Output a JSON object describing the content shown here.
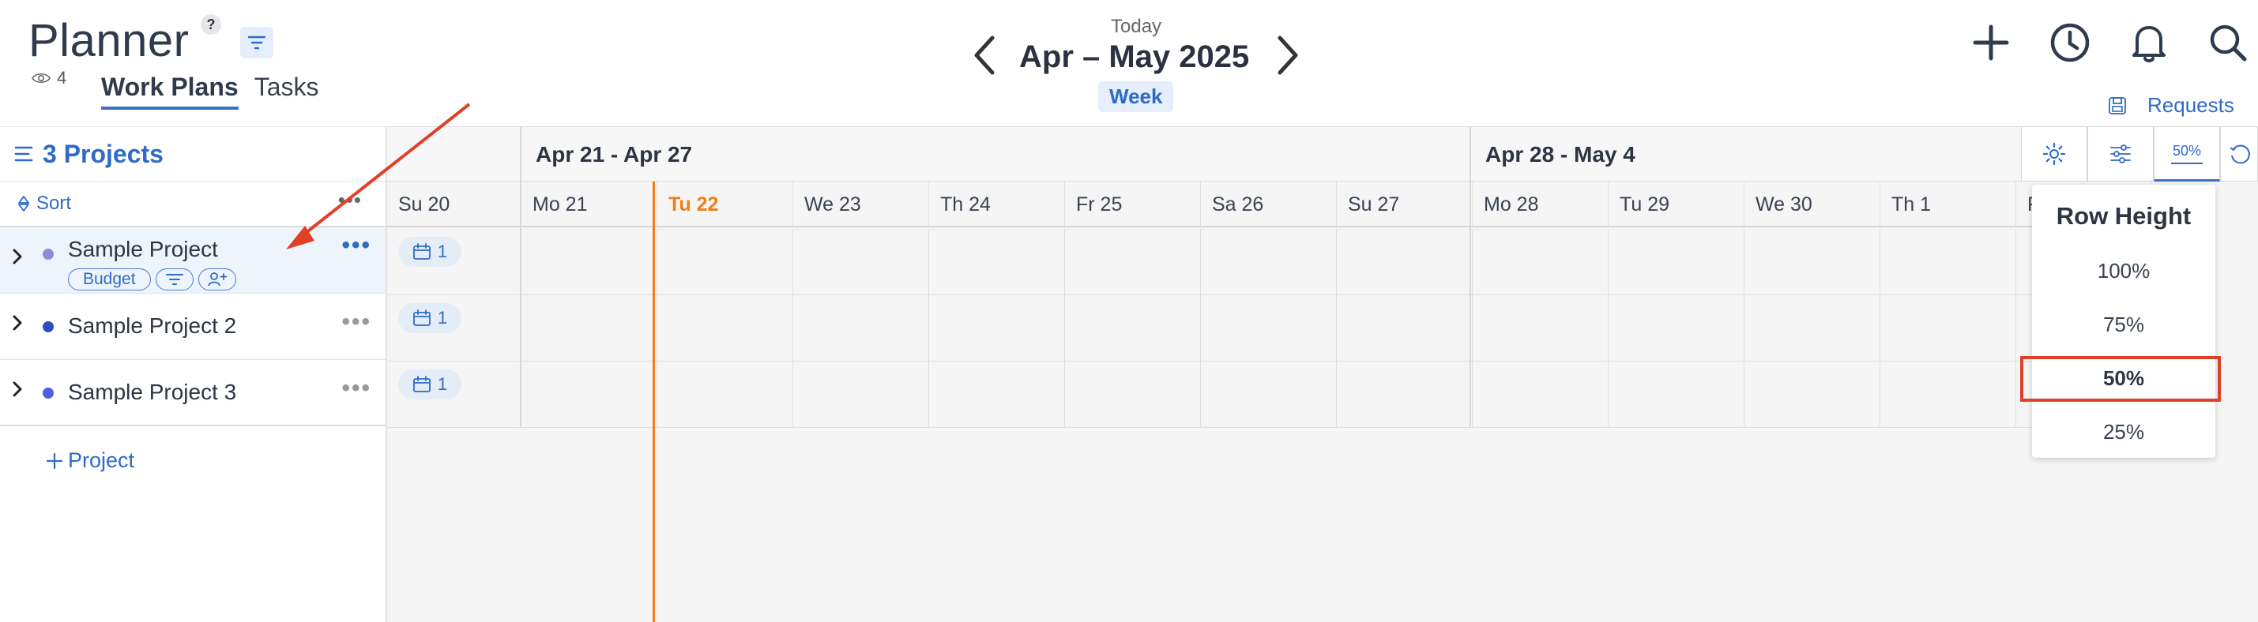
{
  "header": {
    "title": "Planner",
    "help": "?",
    "viewer_count": "4",
    "tabs": [
      {
        "label": "Work Plans",
        "active": true
      },
      {
        "label": "Tasks",
        "active": false
      }
    ],
    "today_label": "Today",
    "date_range": "Apr – May 2025",
    "scale": "Week",
    "requests_label": "Requests",
    "icons": [
      "plus-icon",
      "clock-icon",
      "bell-icon",
      "search-icon"
    ]
  },
  "sidebar": {
    "projects_title": "3 Projects",
    "sort_label": "Sort",
    "projects": [
      {
        "name": "Sample Project",
        "color": "#8a8fd6",
        "selected": true,
        "chips": [
          "Budget"
        ],
        "count": "1"
      },
      {
        "name": "Sample Project 2",
        "color": "#2d4fc2",
        "selected": false,
        "chips": [],
        "count": "1"
      },
      {
        "name": "Sample Project 3",
        "color": "#4f5fe0",
        "selected": false,
        "chips": [],
        "count": "1"
      }
    ],
    "add_project_label": "Project"
  },
  "timeline": {
    "weeks": [
      "Apr 21 - Apr 27",
      "Apr 28 - May 4"
    ],
    "days": [
      "Su 20",
      "Mo 21",
      "Tu 22",
      "We 23",
      "Th 24",
      "Fr 25",
      "Sa 26",
      "Su 27",
      "Mo 28",
      "Tu 29",
      "We 30",
      "Th 1",
      "F"
    ],
    "today_day": "Tu 22",
    "zoom_label": "50%"
  },
  "row_height_menu": {
    "title": "Row Height",
    "options": [
      "100%",
      "75%",
      "50%",
      "25%"
    ],
    "selected": "50%"
  },
  "colors": {
    "accent": "#2e6bc6",
    "today": "#f07f18",
    "annotation": "#e0402a"
  }
}
